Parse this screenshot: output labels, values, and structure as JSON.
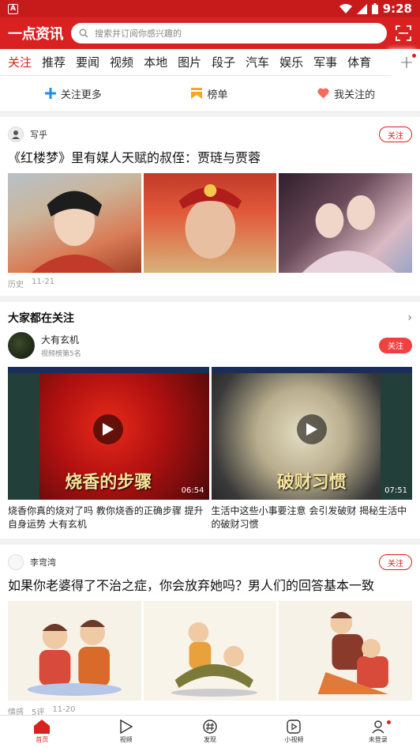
{
  "status_bar": {
    "time": "9:28",
    "app_badge": "A"
  },
  "header": {
    "logo": "一点资讯",
    "search_placeholder": "搜索并订阅你感兴趣的"
  },
  "tabs": [
    "关注",
    "推荐",
    "要闻",
    "视频",
    "本地",
    "图片",
    "段子",
    "汽车",
    "娱乐",
    "军事",
    "体育"
  ],
  "active_tab": "关注",
  "quick_actions": [
    {
      "label": "关注更多",
      "icon": "plus-icon"
    },
    {
      "label": "榜单",
      "icon": "bookmark-icon"
    },
    {
      "label": "我关注的",
      "icon": "heart-icon"
    }
  ],
  "card1": {
    "author": "写乎",
    "follow": "关注",
    "title": "《红楼梦》里有媒人天赋的叔侄：贾琏与贾蓉",
    "category": "历史",
    "date": "11-21"
  },
  "hot": {
    "title": "大家都在关注",
    "channel_name": "大有玄机",
    "channel_sub": "视频榜第5名",
    "follow": "关注",
    "videos": [
      {
        "caption": "烧香的步骤",
        "duration": "06:54",
        "title": "烧香你真的烧对了吗 教你烧香的正确步骤 提升自身运势 大有玄机"
      },
      {
        "caption": "破财习惯",
        "duration": "07:51",
        "title": "生活中这些小事要注意 会引发破财 揭秘生活中的破财习惯"
      }
    ]
  },
  "card2": {
    "author": "李弯湾",
    "follow": "关注",
    "title": "如果你老婆得了不治之症，你会放弃她吗？男人们的回答基本一致",
    "category": "情感",
    "comments": "5评",
    "date": "11-20"
  },
  "bottom_nav": [
    {
      "label": "首页",
      "icon": "home-icon"
    },
    {
      "label": "视频",
      "icon": "play-icon"
    },
    {
      "label": "发现",
      "icon": "hashtag-icon"
    },
    {
      "label": "小视频",
      "icon": "small-video-icon"
    },
    {
      "label": "未登录",
      "icon": "user-icon"
    }
  ],
  "colors": {
    "brand": "#d92121",
    "status_bar": "#c71b1b"
  }
}
